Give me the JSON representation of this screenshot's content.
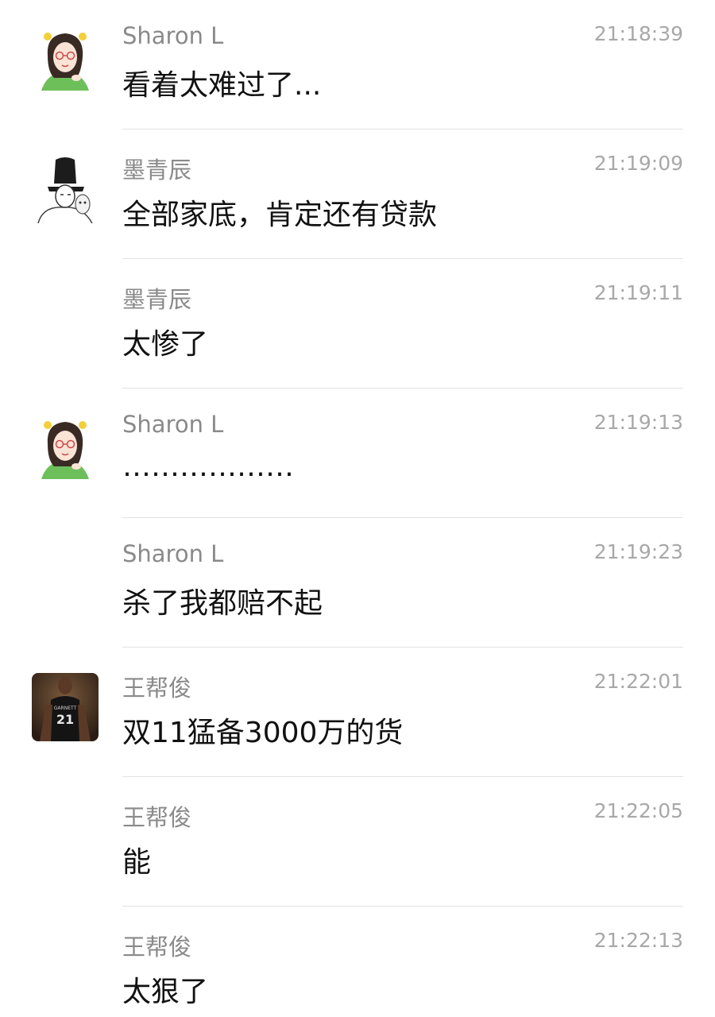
{
  "messages": [
    {
      "sender": "Sharon L",
      "time": "21:18:39",
      "text": "看着太难过了...",
      "avatar": "sharon-avatar"
    },
    {
      "sender": "墨青辰",
      "time": "21:19:09",
      "text": "全部家底，肯定还有贷款",
      "avatar": "moqingchen-avatar"
    },
    {
      "sender": "墨青辰",
      "time": "21:19:11",
      "text": "太惨了",
      "avatar": null
    },
    {
      "sender": "Sharon L",
      "time": "21:19:13",
      "text": "………………",
      "avatar": "sharon-avatar"
    },
    {
      "sender": "Sharon L",
      "time": "21:19:23",
      "text": "杀了我都赔不起",
      "avatar": null
    },
    {
      "sender": "王帮俊",
      "time": "21:22:01",
      "text": "双11猛备3000万的货",
      "avatar": "wangbangjun-avatar"
    },
    {
      "sender": "王帮俊",
      "time": "21:22:05",
      "text": "能",
      "avatar": null
    },
    {
      "sender": "王帮俊",
      "time": "21:22:13",
      "text": "太狠了",
      "avatar": null
    }
  ],
  "avatar_jersey": {
    "name": "GARNETT",
    "number": "21"
  }
}
